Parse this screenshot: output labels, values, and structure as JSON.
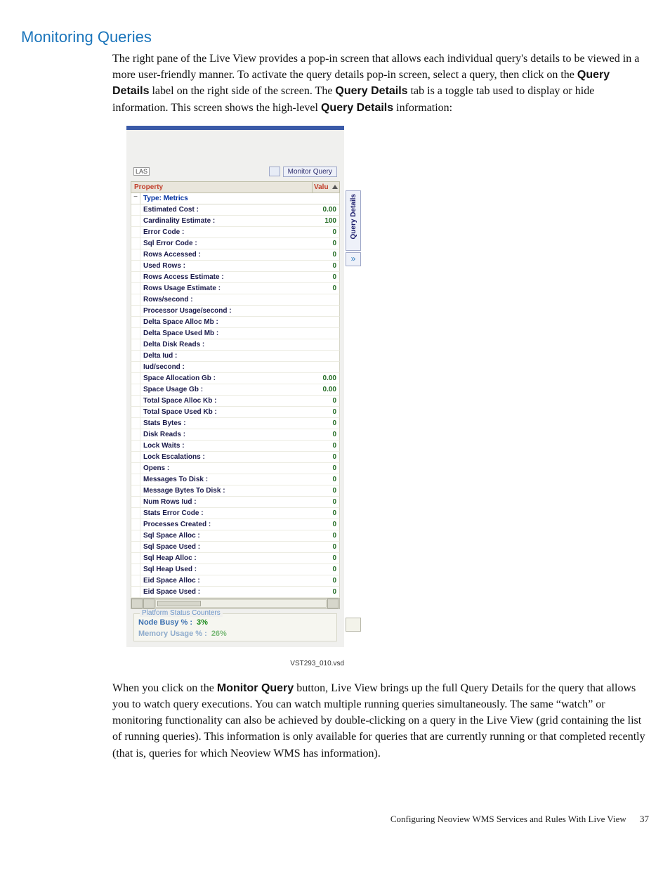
{
  "heading": "Monitoring Queries",
  "para1_parts": [
    "The right pane of the Live View provides a pop-in screen that allows each individual query's details to be viewed in a more user-friendly manner. To activate the query details pop-in screen, select a query, then click on the ",
    "Query Details",
    " label on the right side of the screen. The ",
    "Query Details",
    " tab is a toggle tab used to display or hide information. This screen shows the high-level ",
    "Query Details",
    " information:"
  ],
  "panel": {
    "lead": "LAS",
    "monitor_query_button": "Monitor Query",
    "col_property": "Property",
    "col_value": "Valu",
    "section_type": "Type: Metrics",
    "side_tab": "Query Details",
    "side_chevron": "»",
    "metrics": [
      {
        "name": "Estimated Cost :",
        "value": "0.00"
      },
      {
        "name": "Cardinality Estimate :",
        "value": "100"
      },
      {
        "name": "Error Code :",
        "value": "0"
      },
      {
        "name": "Sql Error Code :",
        "value": "0"
      },
      {
        "name": "Rows Accessed :",
        "value": "0"
      },
      {
        "name": "Used Rows :",
        "value": "0"
      },
      {
        "name": "Rows Access Estimate :",
        "value": "0"
      },
      {
        "name": "Rows Usage Estimate :",
        "value": "0"
      },
      {
        "name": "Rows/second :",
        "value": ""
      },
      {
        "name": "Processor Usage/second :",
        "value": ""
      },
      {
        "name": "Delta Space Alloc Mb :",
        "value": ""
      },
      {
        "name": "Delta Space Used Mb :",
        "value": ""
      },
      {
        "name": "Delta Disk Reads :",
        "value": ""
      },
      {
        "name": "Delta Iud :",
        "value": ""
      },
      {
        "name": "Iud/second :",
        "value": ""
      },
      {
        "name": "Space Allocation Gb :",
        "value": "0.00"
      },
      {
        "name": "Space Usage Gb :",
        "value": "0.00"
      },
      {
        "name": "Total Space Alloc Kb :",
        "value": "0"
      },
      {
        "name": "Total Space Used Kb :",
        "value": "0"
      },
      {
        "name": "Stats Bytes :",
        "value": "0"
      },
      {
        "name": "Disk Reads :",
        "value": "0"
      },
      {
        "name": "Lock Waits :",
        "value": "0"
      },
      {
        "name": "Lock Escalations :",
        "value": "0"
      },
      {
        "name": "Opens :",
        "value": "0"
      },
      {
        "name": "Messages To Disk :",
        "value": "0"
      },
      {
        "name": "Message Bytes To Disk :",
        "value": "0"
      },
      {
        "name": "Num Rows Iud :",
        "value": "0"
      },
      {
        "name": "Stats Error Code :",
        "value": "0"
      },
      {
        "name": "Processes Created :",
        "value": "0"
      },
      {
        "name": "Sql Space Alloc :",
        "value": "0"
      },
      {
        "name": "Sql Space Used :",
        "value": "0"
      },
      {
        "name": "Sql Heap Alloc :",
        "value": "0"
      },
      {
        "name": "Sql Heap Used :",
        "value": "0"
      },
      {
        "name": "Eid Space Alloc :",
        "value": "0"
      },
      {
        "name": "Eid Space Used :",
        "value": "0"
      }
    ],
    "psc": {
      "legend": "Platform Status Counters",
      "rows": [
        {
          "k": "Node Busy % :",
          "v": "3%"
        },
        {
          "k": "Memory Usage % :",
          "v": "26%"
        }
      ]
    }
  },
  "vsd_label": "VST293_010.vsd",
  "para2_parts": [
    "When you click on the ",
    "Monitor Query",
    " button, Live View brings up the full Query Details for the query that allows you to watch query executions. You can watch multiple running queries simultaneously. The same “watch” or monitoring functionality can also be achieved by double-clicking on a query in the Live View (grid containing the list of running queries). This information is only available for queries that are currently running or that completed recently (that is, queries for which Neoview WMS has information)."
  ],
  "footer": {
    "title": "Configuring Neoview WMS Services and Rules With Live View",
    "page": "37"
  }
}
